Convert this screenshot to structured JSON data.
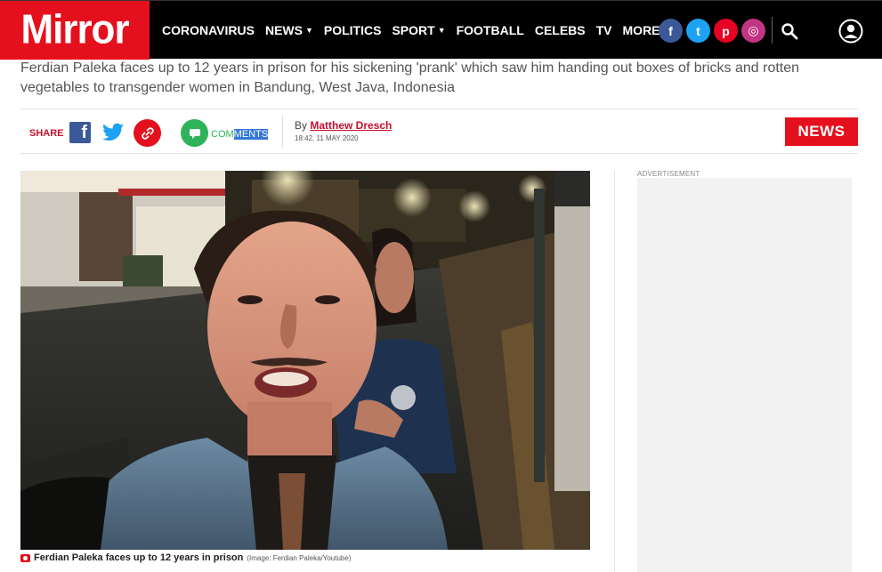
{
  "header": {
    "logo_text": "Mirror",
    "brand_color": "#e5101d",
    "nav": [
      {
        "label": "CORONAVIRUS",
        "dropdown": false
      },
      {
        "label": "NEWS",
        "dropdown": true
      },
      {
        "label": "POLITICS",
        "dropdown": false
      },
      {
        "label": "SPORT",
        "dropdown": true
      },
      {
        "label": "FOOTBALL",
        "dropdown": false
      },
      {
        "label": "CELEBS",
        "dropdown": false
      },
      {
        "label": "TV",
        "dropdown": false
      },
      {
        "label": "MORE",
        "dropdown": true
      }
    ],
    "social": [
      {
        "name": "facebook-icon",
        "glyph": "f",
        "color": "#3b5998"
      },
      {
        "name": "twitter-icon",
        "glyph": "t",
        "color": "#1da1f2"
      },
      {
        "name": "pinterest-icon",
        "glyph": "p",
        "color": "#e60023"
      },
      {
        "name": "instagram-icon",
        "glyph": "◎",
        "color": "#c13584"
      }
    ]
  },
  "article": {
    "standfirst": "Ferdian Paleka faces up to 12 years in prison for his sickening 'prank' which saw him handing out boxes of bricks and rotten vegetables to transgender women in Bandung, West Java, Indonesia",
    "share_label": "SHARE",
    "comments_label_plain": "COM",
    "comments_label_selected": "MENTS",
    "by_prefix": "By ",
    "author": "Matthew Dresch",
    "timestamp": "18:42, 11 MAY 2020",
    "section_tag": "NEWS",
    "image_caption": "Ferdian Paleka faces up to 12 years in prison",
    "image_credit": "(Image: Ferdian Paleka/Youtube)"
  },
  "sidebar": {
    "ad_label": "ADVERTISEMENT"
  }
}
